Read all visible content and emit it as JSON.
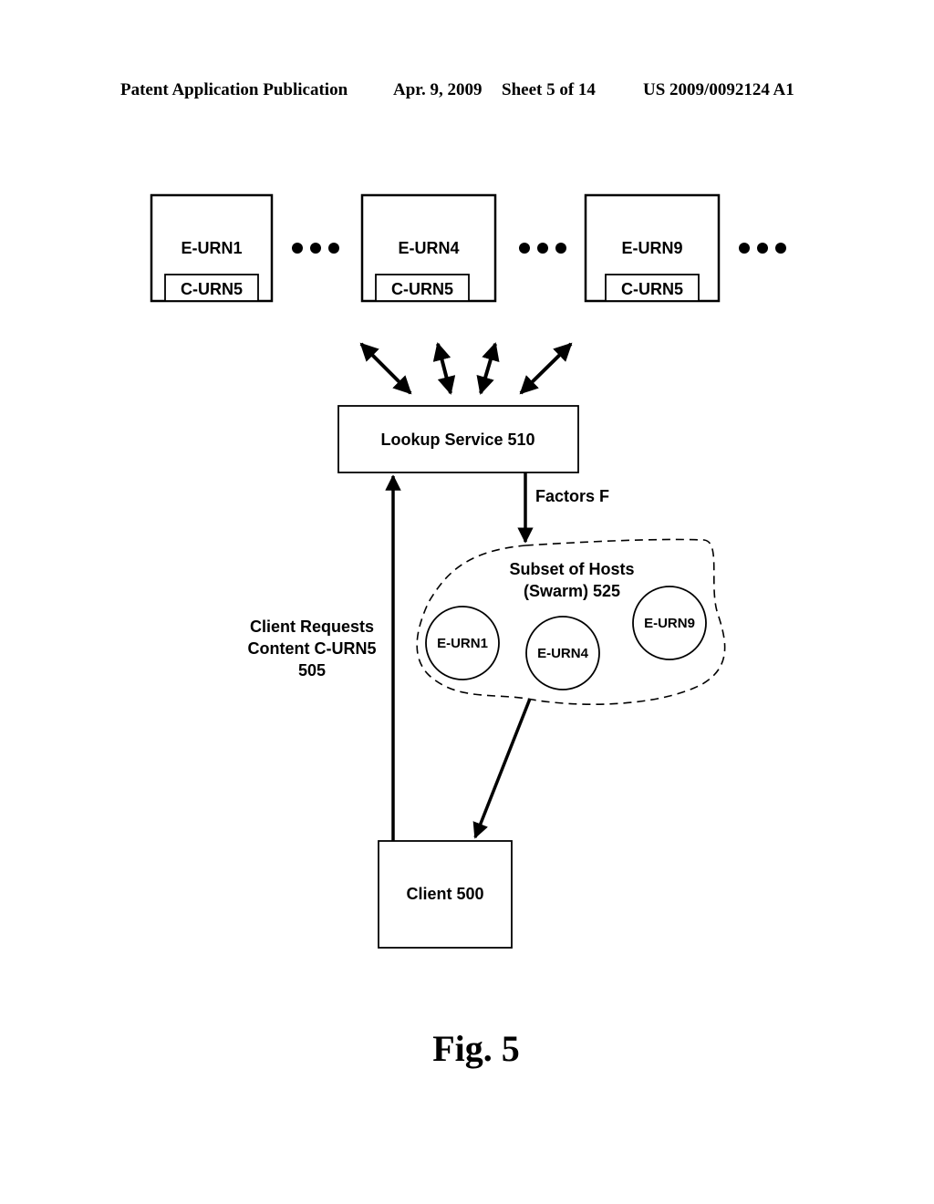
{
  "header": {
    "publication": "Patent Application Publication",
    "date": "Apr. 9, 2009",
    "sheet": "Sheet 5 of 14",
    "patent_number": "US 2009/0092124 A1"
  },
  "diagram": {
    "hosts": [
      {
        "name": "E-URN1",
        "content": "C-URN5"
      },
      {
        "name": "E-URN4",
        "content": "C-URN5"
      },
      {
        "name": "E-URN9",
        "content": "C-URN5"
      }
    ],
    "ellipsis": "●●●",
    "lookup_service": "Lookup Service 510",
    "factors_label": "Factors F",
    "swarm": {
      "title_line1": "Subset of Hosts",
      "title_line2": "(Swarm) 525",
      "members": [
        "E-URN1",
        "E-URN4",
        "E-URN9"
      ]
    },
    "client_request": {
      "line1": "Client Requests",
      "line2": "Content C-URN5",
      "line3": "505"
    },
    "client": "Client 500"
  },
  "figure_label": "Fig. 5"
}
